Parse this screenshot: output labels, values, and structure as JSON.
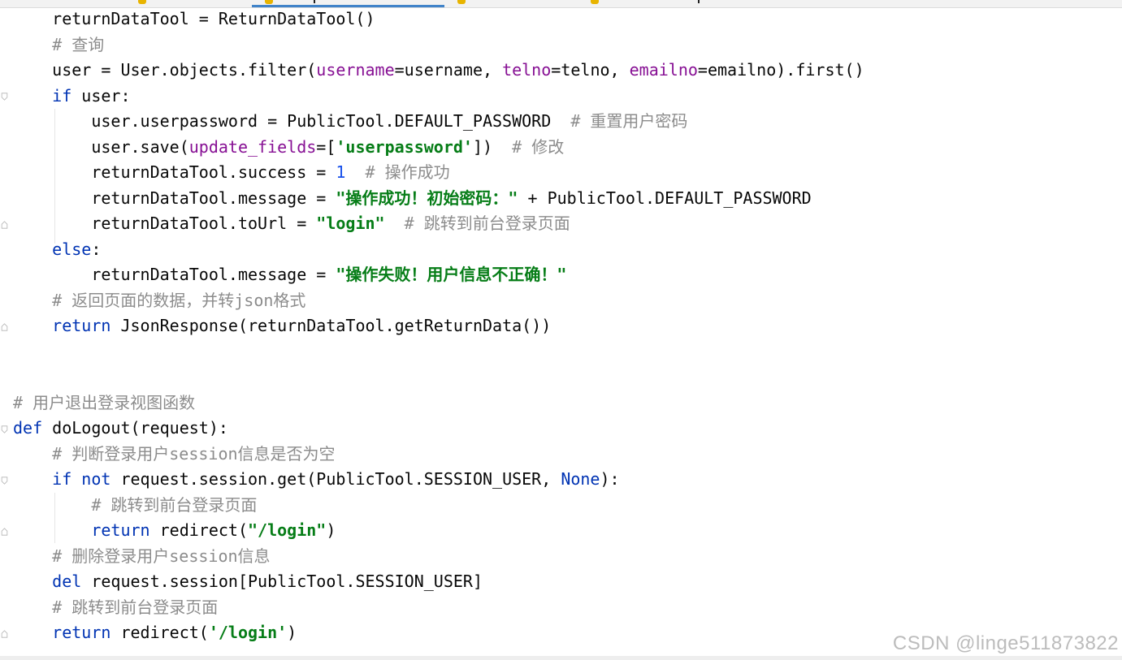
{
  "colors": {
    "keyword": "#0033b3",
    "parameter": "#871094",
    "string": "#067d17",
    "number": "#1750eb",
    "comment": "#8c8c8c",
    "text": "#080808",
    "active_tab_underline": "#4083c9"
  },
  "editor": {
    "lines": [
      {
        "spans": [
          {
            "t": "    returnDataTool = ReturnDataTool()"
          }
        ]
      },
      {
        "spans": [
          {
            "t": "    # 查询",
            "c": "cm"
          }
        ]
      },
      {
        "spans": [
          {
            "t": "    user = User.objects.filter("
          },
          {
            "t": "username",
            "c": "param"
          },
          {
            "t": "=username, "
          },
          {
            "t": "telno",
            "c": "param"
          },
          {
            "t": "=telno, "
          },
          {
            "t": "emailno",
            "c": "param"
          },
          {
            "t": "=emailno).first()"
          }
        ]
      },
      {
        "spans": [
          {
            "t": "    "
          },
          {
            "t": "if",
            "c": "kw"
          },
          {
            "t": " user:"
          }
        ]
      },
      {
        "spans": [
          {
            "t": "        user.userpassword = PublicTool.DEFAULT_PASSWORD  "
          },
          {
            "t": "# 重置用户密码",
            "c": "cm"
          }
        ]
      },
      {
        "spans": [
          {
            "t": "        user.save("
          },
          {
            "t": "update_fields",
            "c": "param"
          },
          {
            "t": "=["
          },
          {
            "t": "'userpassword'",
            "c": "str"
          },
          {
            "t": "])  "
          },
          {
            "t": "# 修改",
            "c": "cm"
          }
        ]
      },
      {
        "spans": [
          {
            "t": "        returnDataTool.success = "
          },
          {
            "t": "1",
            "c": "num"
          },
          {
            "t": "  "
          },
          {
            "t": "# 操作成功",
            "c": "cm"
          }
        ]
      },
      {
        "spans": [
          {
            "t": "        returnDataTool.message = "
          },
          {
            "t": "\"操作成功！初始密码：\"",
            "c": "str"
          },
          {
            "t": " + PublicTool.DEFAULT_PASSWORD"
          }
        ]
      },
      {
        "spans": [
          {
            "t": "        returnDataTool.toUrl = "
          },
          {
            "t": "\"login\"",
            "c": "str"
          },
          {
            "t": "  "
          },
          {
            "t": "# 跳转到前台登录页面",
            "c": "cm"
          }
        ]
      },
      {
        "spans": [
          {
            "t": "    "
          },
          {
            "t": "else",
            "c": "kw"
          },
          {
            "t": ":"
          }
        ]
      },
      {
        "spans": [
          {
            "t": "        returnDataTool.message = "
          },
          {
            "t": "\"操作失败！用户信息不正确！\"",
            "c": "str"
          }
        ]
      },
      {
        "spans": [
          {
            "t": "    # 返回页面的数据，并转json格式",
            "c": "cm"
          }
        ]
      },
      {
        "spans": [
          {
            "t": "    "
          },
          {
            "t": "return",
            "c": "kw"
          },
          {
            "t": " JsonResponse(returnDataTool.getReturnData())"
          }
        ]
      },
      {
        "spans": [
          {
            "t": ""
          }
        ]
      },
      {
        "spans": [
          {
            "t": ""
          }
        ]
      },
      {
        "spans": [
          {
            "t": "# 用户退出登录视图函数",
            "c": "cm"
          }
        ]
      },
      {
        "spans": [
          {
            "t": "def",
            "c": "kw"
          },
          {
            "t": " doLogout(request):"
          }
        ]
      },
      {
        "spans": [
          {
            "t": "    # 判断登录用户session信息是否为空",
            "c": "cm"
          }
        ]
      },
      {
        "spans": [
          {
            "t": "    "
          },
          {
            "t": "if not",
            "c": "kw"
          },
          {
            "t": " request.session.get(PublicTool.SESSION_USER, "
          },
          {
            "t": "None",
            "c": "kw"
          },
          {
            "t": "):"
          }
        ]
      },
      {
        "spans": [
          {
            "t": "        # 跳转到前台登录页面",
            "c": "cm"
          }
        ]
      },
      {
        "spans": [
          {
            "t": "        "
          },
          {
            "t": "return",
            "c": "kw"
          },
          {
            "t": " redirect("
          },
          {
            "t": "\"/login\"",
            "c": "str"
          },
          {
            "t": ")"
          }
        ]
      },
      {
        "spans": [
          {
            "t": "    # 删除登录用户session信息",
            "c": "cm"
          }
        ]
      },
      {
        "spans": [
          {
            "t": "    "
          },
          {
            "t": "del",
            "c": "kw"
          },
          {
            "t": " request.session[PublicTool.SESSION_USER]"
          }
        ]
      },
      {
        "spans": [
          {
            "t": "    # 跳转到前台登录页面",
            "c": "cm"
          }
        ]
      },
      {
        "spans": [
          {
            "t": "    "
          },
          {
            "t": "return",
            "c": "kw"
          },
          {
            "t": " redirect("
          },
          {
            "t": "'/login'",
            "c": "str"
          },
          {
            "t": ")"
          }
        ]
      }
    ]
  },
  "watermark": {
    "text": "CSDN @linge511873822"
  }
}
